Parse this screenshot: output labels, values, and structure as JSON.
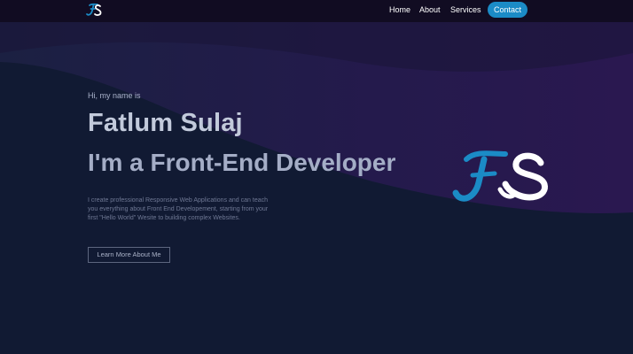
{
  "nav": {
    "logo": "FS",
    "links": [
      "Home",
      "About",
      "Services"
    ],
    "contact_label": "Contact"
  },
  "hero": {
    "greeting": "Hi, my name is",
    "name": "Fatlum Sulaj",
    "role": "I'm a Front-End Developer",
    "description": "I create professional Responsive Web Applications and can teach you everything about Front End Developement, starting from your first \"Hello World\" Wesite to building complex Websites.",
    "cta_label": "Learn More About Me",
    "logo": "FS"
  },
  "colors": {
    "background": "#111a33",
    "navbar": "#110c22",
    "accent": "#1b8bc6",
    "wave": "#1d1a45"
  }
}
